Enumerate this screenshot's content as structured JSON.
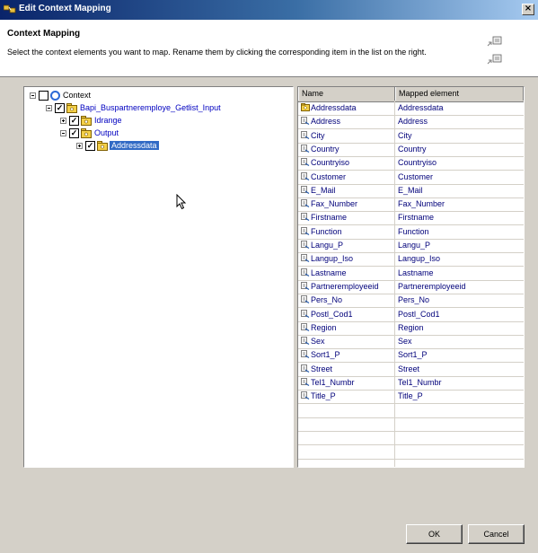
{
  "window": {
    "title": "Edit Context Mapping",
    "close_symbol": "×"
  },
  "header": {
    "title": "Context Mapping",
    "description": "Select the context elements you want to map. Rename them by clicking the corresponding item in the list on the right."
  },
  "tree": {
    "nodes": [
      {
        "label": "Context",
        "icon": "context-node-icon"
      },
      {
        "label": "Bapi_Buspartneremploye_Getlist_Input",
        "icon": "folder-icon",
        "checked": true
      },
      {
        "label": "Idrange",
        "icon": "folder-icon",
        "checked": true
      },
      {
        "label": "Output",
        "icon": "folder-icon",
        "checked": true
      },
      {
        "label": "Addressdata",
        "icon": "folder-icon",
        "checked": true,
        "selected": true
      }
    ]
  },
  "table": {
    "columns": [
      "Name",
      "Mapped element"
    ],
    "rows": [
      {
        "name": "Addressdata",
        "mapped": "Addressdata",
        "icon": "node-icon"
      },
      {
        "name": "Address",
        "mapped": "Address",
        "icon": "attribute-icon"
      },
      {
        "name": "City",
        "mapped": "City",
        "icon": "attribute-icon"
      },
      {
        "name": "Country",
        "mapped": "Country",
        "icon": "attribute-icon"
      },
      {
        "name": "Countryiso",
        "mapped": "Countryiso",
        "icon": "attribute-icon"
      },
      {
        "name": "Customer",
        "mapped": "Customer",
        "icon": "attribute-icon"
      },
      {
        "name": "E_Mail",
        "mapped": "E_Mail",
        "icon": "attribute-icon"
      },
      {
        "name": "Fax_Number",
        "mapped": "Fax_Number",
        "icon": "attribute-icon"
      },
      {
        "name": "Firstname",
        "mapped": "Firstname",
        "icon": "attribute-icon"
      },
      {
        "name": "Function",
        "mapped": "Function",
        "icon": "attribute-icon"
      },
      {
        "name": "Langu_P",
        "mapped": "Langu_P",
        "icon": "attribute-icon"
      },
      {
        "name": "Langup_Iso",
        "mapped": "Langup_Iso",
        "icon": "attribute-icon"
      },
      {
        "name": "Lastname",
        "mapped": "Lastname",
        "icon": "attribute-icon"
      },
      {
        "name": "Partneremployeeid",
        "mapped": "Partneremployeeid",
        "icon": "attribute-icon"
      },
      {
        "name": "Pers_No",
        "mapped": "Pers_No",
        "icon": "attribute-icon"
      },
      {
        "name": "Postl_Cod1",
        "mapped": "Postl_Cod1",
        "icon": "attribute-icon"
      },
      {
        "name": "Region",
        "mapped": "Region",
        "icon": "attribute-icon"
      },
      {
        "name": "Sex",
        "mapped": "Sex",
        "icon": "attribute-icon"
      },
      {
        "name": "Sort1_P",
        "mapped": "Sort1_P",
        "icon": "attribute-icon"
      },
      {
        "name": "Street",
        "mapped": "Street",
        "icon": "attribute-icon"
      },
      {
        "name": "Tel1_Numbr",
        "mapped": "Tel1_Numbr",
        "icon": "attribute-icon"
      },
      {
        "name": "Title_P",
        "mapped": "Title_P",
        "icon": "attribute-icon"
      }
    ],
    "empty_rows": 6
  },
  "buttons": {
    "ok": "OK",
    "cancel": "Cancel"
  },
  "colors": {
    "titlebar": "#0a246a",
    "link": "#0000c0",
    "selection": "#316ac5"
  }
}
